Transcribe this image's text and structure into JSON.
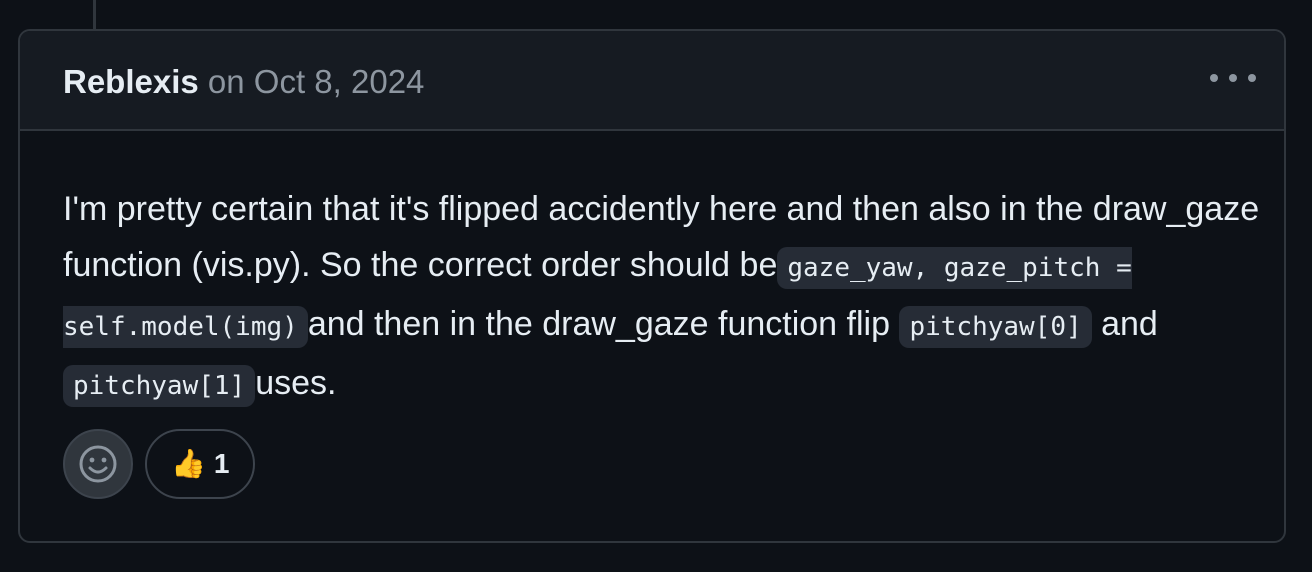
{
  "comment": {
    "author": "Reblexis",
    "date": "on Oct 8, 2024",
    "body": {
      "text_1": "I'm pretty certain that it's flipped accidently here and then also in the draw_gaze function (vis.py). So the correct order should be",
      "code_1": "gaze_yaw, gaze_pitch = self.model(img)",
      "text_2": "and then in the draw_gaze function flip ",
      "code_2": "pitchyaw[0]",
      "text_3": " and ",
      "code_3": "pitchyaw[1]",
      "text_4": "uses."
    },
    "reactions": [
      {
        "emoji": "👍",
        "icon": "thumbs-up-icon",
        "count": "1"
      }
    ]
  },
  "icons": {
    "more": "kebab-horizontal-icon",
    "add_reaction": "smiley-icon"
  },
  "colors": {
    "background": "#0d1117",
    "header_background": "#161b22",
    "border": "#30363d",
    "text": "#e6edf3",
    "muted_text": "#8d96a0",
    "code_background": "#262c36"
  }
}
